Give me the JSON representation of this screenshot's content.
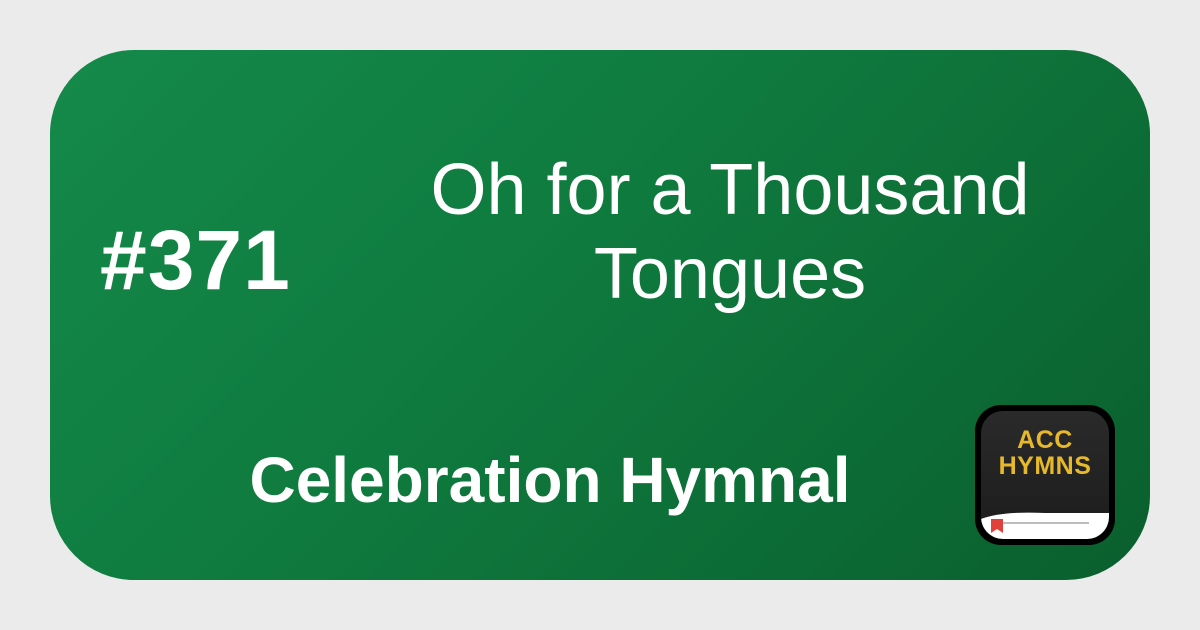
{
  "hymn": {
    "number": "#371",
    "title": "Oh for a Thousand\nTongues",
    "hymnal": "Celebration Hymnal"
  },
  "logo": {
    "text": "ACC\nHYMNS",
    "icon": "book-bookmark-icon"
  },
  "colors": {
    "background": "#ebebeb",
    "card_gradient_start": "#148a4a",
    "card_gradient_end": "#0a5f2d",
    "text": "#ffffff",
    "logo_background": "#1c1c1c",
    "logo_text": "#e7b92a",
    "bookmark": "#e0413a"
  }
}
